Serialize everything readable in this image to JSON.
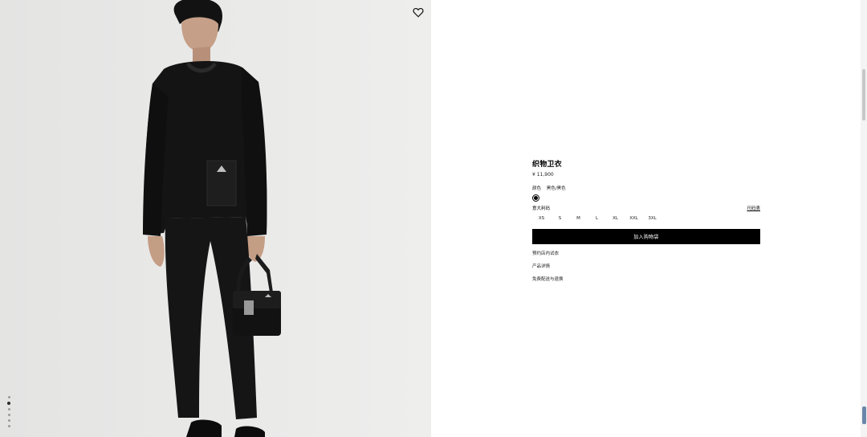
{
  "icons": {
    "wishlist": "heart-icon",
    "color_swatch": "black"
  },
  "colors": {
    "image_bg": "#e9e9e8",
    "button_bg": "#000000",
    "button_text": "#ffffff"
  },
  "product": {
    "title": "织物卫衣",
    "price": "¥ 11,900"
  },
  "color": {
    "label": "颜色",
    "value": "黑色/黑色"
  },
  "size": {
    "label": "意大利码",
    "guide": "尺码表",
    "options": [
      "XS",
      "S",
      "M",
      "L",
      "XL",
      "XXL",
      "3XL"
    ]
  },
  "actions": {
    "add_to_cart": "加入购物袋"
  },
  "links": [
    "预约店内试衣",
    "产品详情",
    "免费配送与退换"
  ],
  "gallery": {
    "image_count": 6,
    "active_index": 1
  }
}
